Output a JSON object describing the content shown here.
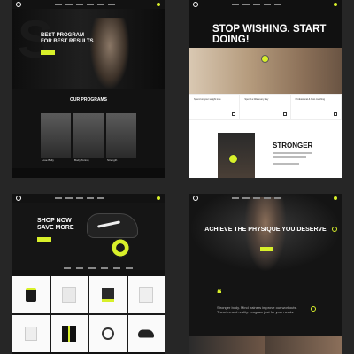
{
  "pages": [
    {
      "hero_title": "BEST PROGRAM FOR BEST RESULTS",
      "hero_button": "",
      "section_title": "OUR PROGRAMS",
      "programs": [
        {
          "label": "Lose Belly"
        },
        {
          "label": "Body Toning"
        },
        {
          "label": "Strength"
        }
      ]
    },
    {
      "headline": "STOP WISHING. START DOING!",
      "cards": [
        {
          "text": "Spend on your weight lose"
        },
        {
          "text": "Spend a little every day"
        },
        {
          "text": "Professional & best coaching"
        }
      ],
      "strong_title": "STRONGER"
    },
    {
      "hero_title": "SHOP NOW SAVE MORE",
      "filters": [
        "",
        "",
        "",
        "",
        "",
        ""
      ],
      "products": [
        {
          "name": "Supplement",
          "icon": "supplement-jar-icon"
        },
        {
          "name": "T-shirt",
          "icon": "tshirt-icon"
        },
        {
          "name": "Box",
          "icon": "box-icon"
        },
        {
          "name": "Shirt",
          "icon": "shirt-icon"
        },
        {
          "name": "Bag",
          "icon": "bag-icon"
        },
        {
          "name": "Supplement Pack",
          "icon": "pack-icon"
        },
        {
          "name": "Jump Rope",
          "icon": "rope-icon"
        },
        {
          "name": "Shoes",
          "icon": "shoe-icon"
        }
      ]
    },
    {
      "hero_title": "ACHIEVE THE PHYSIQUE YOU DESERVE",
      "quote": "Stronger body. Mind trainers improve our workouts. Theories and reality: program just for your needs."
    }
  ],
  "colors": {
    "accent": "#d8f02a",
    "dark": "#121212",
    "light": "#ffffff"
  }
}
